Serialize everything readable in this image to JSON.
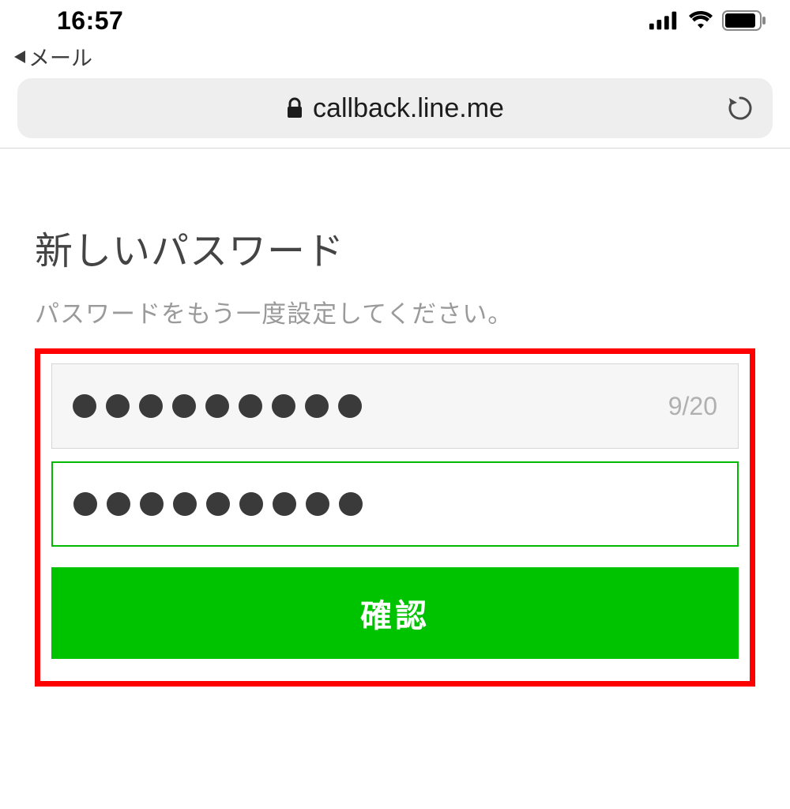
{
  "status": {
    "time": "16:57",
    "back_app": "メール"
  },
  "browser": {
    "url": "callback.line.me"
  },
  "page": {
    "title": "新しいパスワード",
    "subtitle": "パスワードをもう一度設定してください。"
  },
  "form": {
    "password_len": 9,
    "password_max": 20,
    "counter": "9/20",
    "confirm_len": 9,
    "button": "確認"
  }
}
